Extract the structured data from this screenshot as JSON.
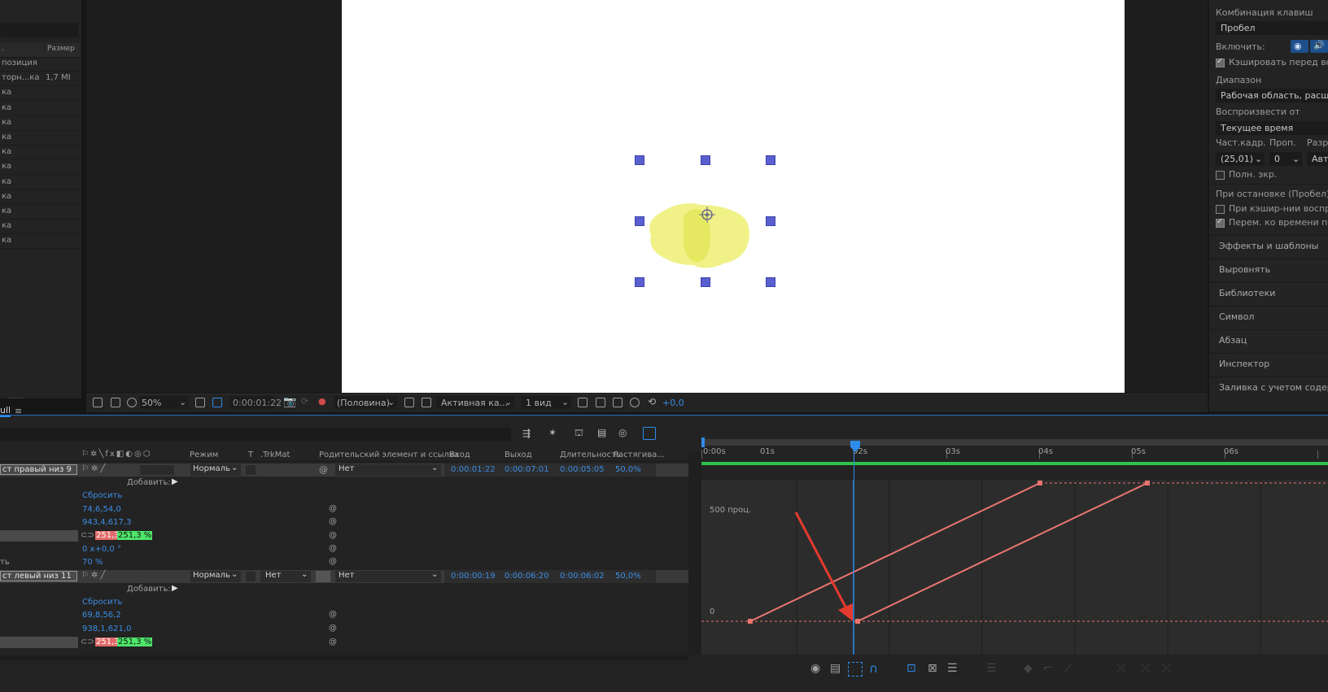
{
  "project": {
    "headers": {
      "col1": ".",
      "col2": "Размер"
    },
    "rows": [
      {
        "name": "позиция",
        "size": ""
      },
      {
        "name": "торн...ка",
        "size": "1,7 MI"
      },
      {
        "name": "ка",
        "size": ""
      },
      {
        "name": "ка",
        "size": ""
      },
      {
        "name": "ка",
        "size": ""
      },
      {
        "name": "ка",
        "size": ""
      },
      {
        "name": "ка",
        "size": ""
      },
      {
        "name": "ка",
        "size": ""
      },
      {
        "name": "ка",
        "size": ""
      },
      {
        "name": "ка",
        "size": ""
      },
      {
        "name": "ка",
        "size": ""
      },
      {
        "name": "ка",
        "size": ""
      },
      {
        "name": "ка",
        "size": ""
      }
    ]
  },
  "viewer_bar": {
    "zoom": "50%",
    "timecode": "0:00:01:22",
    "resolution": "(Половина)",
    "camera": "Активная ка...",
    "views": "1 вид",
    "exposure": "+0,0"
  },
  "right_panel": {
    "shortcut_label": "Комбинация клавиш",
    "shortcut_value": "Пробел",
    "include_label": "Включить:",
    "cache_label": "Кэшировать перед восп",
    "range_label": "Диапазон",
    "range_value": "Рабочая область, расшире",
    "play_from_label": "Воспроизвести от",
    "play_from_value": "Текущее время",
    "fps_label": "Част.кадр.",
    "skip_label": "Проп.",
    "res_label": "Разр",
    "fps_value": "(25,01)",
    "skip_value": "0",
    "res_value": "Авт",
    "fullscreen_label": "Полн. экр.",
    "on_stop_label": "При остановке (Пробел):",
    "on_stop_opt1": "При кэшир-нии воспр. и",
    "on_stop_opt2": "Перем. ко времени пред",
    "sections": [
      "Эффекты и шаблоны",
      "Выровнять",
      "Библиотеки",
      "Символ",
      "Абзац",
      "Инспектор",
      "Заливка с учетом содерж"
    ]
  },
  "timeline": {
    "tab": "ull",
    "columns": {
      "mode": "Режим",
      "t": "T",
      "trkmat": ".TrkMat",
      "parent": "Родительский элемент и ссылка",
      "in": "Вход",
      "out": "Выход",
      "duration": "Длительность",
      "stretch": "Растягива..."
    },
    "layer1": {
      "name": "ст правый низ 9",
      "mode": "Нормаль",
      "parent": "Нет",
      "in": "0:00:01:22",
      "out": "0:00:07:01",
      "duration": "0:00:05:05",
      "stretch": "50,0%",
      "add": "Добавить:",
      "reset": "Сбросить",
      "anchor": "74,6,54,0",
      "position": "943,4,617,3",
      "scale_x": "251,3",
      "scale_y": "251,3 %",
      "rotation": "0 x+0,0 °",
      "opacity": "70 %",
      "opacity_label": "ть"
    },
    "layer2": {
      "name": "ст левый низ 11",
      "mode": "Нормаль",
      "trkmat": "Нет",
      "parent": "Нет",
      "in": "0:00:00:19",
      "out": "0:00:06:20",
      "duration": "0:00:06:02",
      "stretch": "50,0%",
      "add": "Добавить:",
      "reset": "Сбросить",
      "anchor": "69,8,56,2",
      "position": "938,1,621,0",
      "scale_x": "251,3",
      "scale_y": "251,3 %"
    },
    "ruler_ticks": [
      "0:00s",
      "01s",
      "02s",
      "03s",
      "04s",
      "05s",
      "06s"
    ],
    "graph_labels": {
      "top": "500 проц.",
      "bottom": "0"
    }
  },
  "colors": {
    "accent": "#2d8ceb",
    "graph_line": "#e8756e",
    "arrow": "#e53a2f",
    "green_bar": "#2fc24a"
  }
}
